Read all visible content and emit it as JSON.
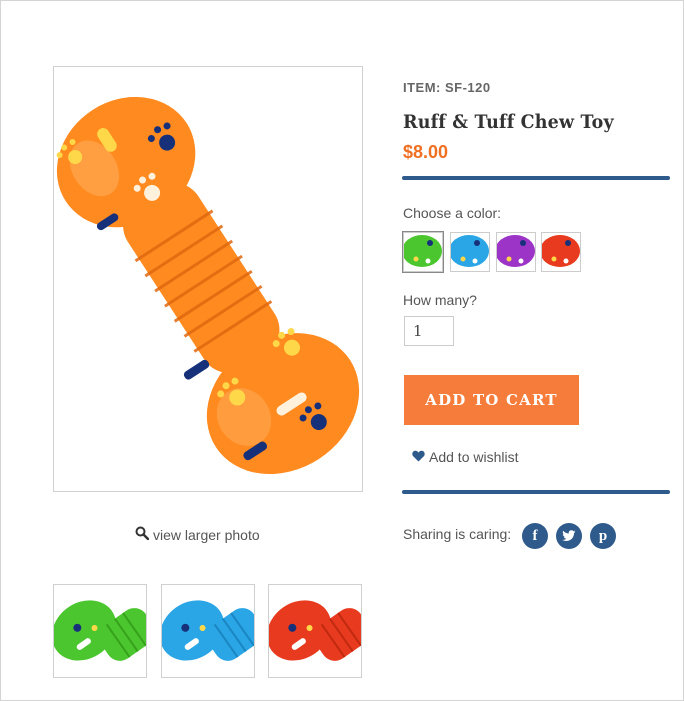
{
  "product": {
    "item_code": "ITEM: SF-120",
    "title": "Ruff & Tuff Chew Toy",
    "price": "$8.00"
  },
  "gallery": {
    "larger_photo_label": "view larger photo",
    "thumbnails": [
      "green",
      "blue",
      "red"
    ]
  },
  "options": {
    "color_label": "Choose a color:",
    "colors": [
      {
        "name": "green",
        "hex": "#4cc62f",
        "selected": true
      },
      {
        "name": "blue",
        "hex": "#2aa5e6",
        "selected": false
      },
      {
        "name": "purple",
        "hex": "#9b34c7",
        "selected": false
      },
      {
        "name": "red",
        "hex": "#e83a1e",
        "selected": false
      }
    ],
    "quantity_label": "How many?",
    "quantity_value": "1"
  },
  "actions": {
    "add_to_cart": "ADD TO CART",
    "wishlist": "Add to wishlist"
  },
  "sharing": {
    "label": "Sharing is caring:",
    "networks": [
      {
        "name": "facebook",
        "glyph": "f"
      },
      {
        "name": "twitter",
        "glyph": "t"
      },
      {
        "name": "pinterest",
        "glyph": "p"
      }
    ]
  },
  "colors": {
    "accent": "#f57c3a",
    "price": "#f07022",
    "rule": "#2f5a8c",
    "product_main": "#ff8a1f"
  }
}
